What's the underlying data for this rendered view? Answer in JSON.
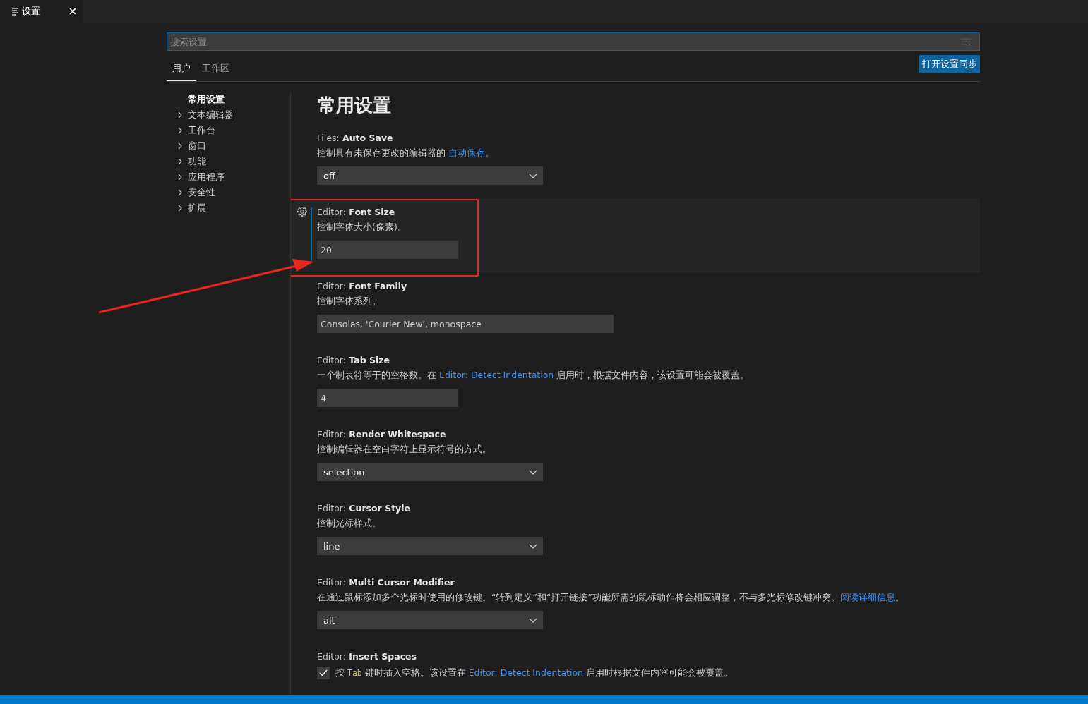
{
  "editor_tabs": [
    {
      "title": "设置",
      "selected": true
    }
  ],
  "search": {
    "placeholder": "搜索设置"
  },
  "scope_tabs": [
    {
      "label": "用户",
      "selected": true
    },
    {
      "label": "工作区",
      "selected": false
    }
  ],
  "sync_button": "打开设置同步",
  "toc": [
    {
      "kind": "section",
      "label": "常用设置",
      "selected": true
    },
    {
      "kind": "group",
      "label": "文本编辑器",
      "selected": false
    },
    {
      "kind": "group",
      "label": "工作台",
      "selected": false
    },
    {
      "kind": "group",
      "label": "窗口",
      "selected": false
    },
    {
      "kind": "group",
      "label": "功能",
      "selected": false
    },
    {
      "kind": "group",
      "label": "应用程序",
      "selected": false
    },
    {
      "kind": "group",
      "label": "安全性",
      "selected": false
    },
    {
      "kind": "group",
      "label": "扩展",
      "selected": false
    }
  ],
  "section_title": "常用设置",
  "settings": [
    {
      "kind": "select",
      "category": "Files:",
      "name": "Auto Save",
      "description": [
        {
          "kind": "text",
          "text": "控制具有未保存更改的编辑器的 "
        },
        {
          "kind": "link",
          "text": "自动保存"
        },
        {
          "kind": "text",
          "text": "。"
        }
      ],
      "value": "off",
      "focused": false,
      "annotated": false
    },
    {
      "kind": "number",
      "category": "Editor:",
      "name": "Font Size",
      "description": [
        {
          "kind": "text",
          "text": "控制字体大小(像素)。"
        }
      ],
      "value": "20",
      "focused": true,
      "annotated": true
    },
    {
      "kind": "text",
      "category": "Editor:",
      "name": "Font Family",
      "description": [
        {
          "kind": "text",
          "text": "控制字体系列。"
        }
      ],
      "value": "Consolas, 'Courier New', monospace",
      "focused": false,
      "annotated": false
    },
    {
      "kind": "number",
      "category": "Editor:",
      "name": "Tab Size",
      "description": [
        {
          "kind": "text",
          "text": "一个制表符等于的空格数。在 "
        },
        {
          "kind": "link",
          "text": "Editor: Detect Indentation"
        },
        {
          "kind": "text",
          "text": " 启用时，根据文件内容，该设置可能会被覆盖。"
        }
      ],
      "value": "4",
      "focused": false,
      "annotated": false
    },
    {
      "kind": "select",
      "category": "Editor:",
      "name": "Render Whitespace",
      "description": [
        {
          "kind": "text",
          "text": "控制编辑器在空白字符上显示符号的方式。"
        }
      ],
      "value": "selection",
      "focused": false,
      "annotated": false
    },
    {
      "kind": "select",
      "category": "Editor:",
      "name": "Cursor Style",
      "description": [
        {
          "kind": "text",
          "text": "控制光标样式。"
        }
      ],
      "value": "line",
      "focused": false,
      "annotated": false
    },
    {
      "kind": "select",
      "category": "Editor:",
      "name": "Multi Cursor Modifier",
      "description": [
        {
          "kind": "text",
          "text": "在通过鼠标添加多个光标时使用的修改键。“转到定义”和“打开链接”功能所需的鼠标动作将会相应调整，不与多光标修改键冲突。"
        },
        {
          "kind": "link",
          "text": "阅读详细信息"
        },
        {
          "kind": "text",
          "text": "。"
        }
      ],
      "value": "alt",
      "focused": false,
      "annotated": false
    },
    {
      "kind": "checkbox",
      "category": "Editor:",
      "name": "Insert Spaces",
      "description": [
        {
          "kind": "text",
          "text": "按 "
        },
        {
          "kind": "code",
          "text": "Tab"
        },
        {
          "kind": "text",
          "text": " 键时插入空格。该设置在 "
        },
        {
          "kind": "link",
          "text": "Editor: Detect Indentation"
        },
        {
          "kind": "text",
          "text": " 启用时根据文件内容可能会被覆盖。"
        }
      ],
      "checked": true,
      "focused": false,
      "annotated": false
    }
  ]
}
